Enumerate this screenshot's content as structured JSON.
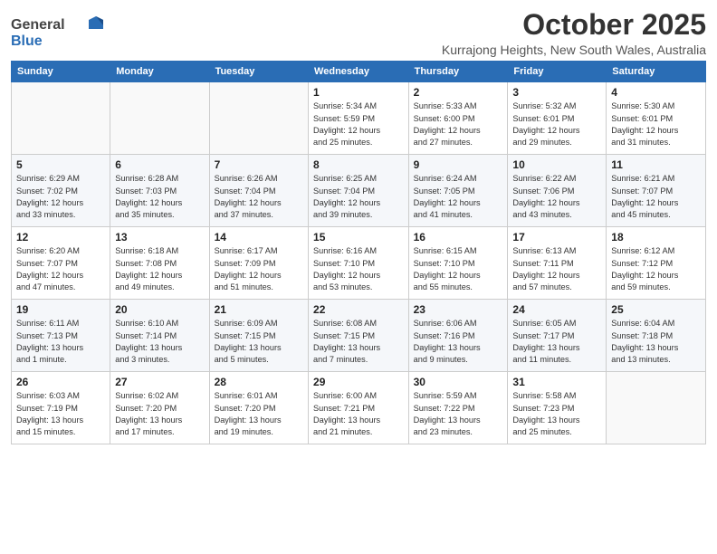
{
  "logo": {
    "general": "General",
    "blue": "Blue"
  },
  "header": {
    "month_title": "October 2025",
    "location": "Kurrajong Heights, New South Wales, Australia"
  },
  "weekdays": [
    "Sunday",
    "Monday",
    "Tuesday",
    "Wednesday",
    "Thursday",
    "Friday",
    "Saturday"
  ],
  "weeks": [
    [
      {
        "day": "",
        "info": ""
      },
      {
        "day": "",
        "info": ""
      },
      {
        "day": "",
        "info": ""
      },
      {
        "day": "1",
        "info": "Sunrise: 5:34 AM\nSunset: 5:59 PM\nDaylight: 12 hours\nand 25 minutes."
      },
      {
        "day": "2",
        "info": "Sunrise: 5:33 AM\nSunset: 6:00 PM\nDaylight: 12 hours\nand 27 minutes."
      },
      {
        "day": "3",
        "info": "Sunrise: 5:32 AM\nSunset: 6:01 PM\nDaylight: 12 hours\nand 29 minutes."
      },
      {
        "day": "4",
        "info": "Sunrise: 5:30 AM\nSunset: 6:01 PM\nDaylight: 12 hours\nand 31 minutes."
      }
    ],
    [
      {
        "day": "5",
        "info": "Sunrise: 6:29 AM\nSunset: 7:02 PM\nDaylight: 12 hours\nand 33 minutes."
      },
      {
        "day": "6",
        "info": "Sunrise: 6:28 AM\nSunset: 7:03 PM\nDaylight: 12 hours\nand 35 minutes."
      },
      {
        "day": "7",
        "info": "Sunrise: 6:26 AM\nSunset: 7:04 PM\nDaylight: 12 hours\nand 37 minutes."
      },
      {
        "day": "8",
        "info": "Sunrise: 6:25 AM\nSunset: 7:04 PM\nDaylight: 12 hours\nand 39 minutes."
      },
      {
        "day": "9",
        "info": "Sunrise: 6:24 AM\nSunset: 7:05 PM\nDaylight: 12 hours\nand 41 minutes."
      },
      {
        "day": "10",
        "info": "Sunrise: 6:22 AM\nSunset: 7:06 PM\nDaylight: 12 hours\nand 43 minutes."
      },
      {
        "day": "11",
        "info": "Sunrise: 6:21 AM\nSunset: 7:07 PM\nDaylight: 12 hours\nand 45 minutes."
      }
    ],
    [
      {
        "day": "12",
        "info": "Sunrise: 6:20 AM\nSunset: 7:07 PM\nDaylight: 12 hours\nand 47 minutes."
      },
      {
        "day": "13",
        "info": "Sunrise: 6:18 AM\nSunset: 7:08 PM\nDaylight: 12 hours\nand 49 minutes."
      },
      {
        "day": "14",
        "info": "Sunrise: 6:17 AM\nSunset: 7:09 PM\nDaylight: 12 hours\nand 51 minutes."
      },
      {
        "day": "15",
        "info": "Sunrise: 6:16 AM\nSunset: 7:10 PM\nDaylight: 12 hours\nand 53 minutes."
      },
      {
        "day": "16",
        "info": "Sunrise: 6:15 AM\nSunset: 7:10 PM\nDaylight: 12 hours\nand 55 minutes."
      },
      {
        "day": "17",
        "info": "Sunrise: 6:13 AM\nSunset: 7:11 PM\nDaylight: 12 hours\nand 57 minutes."
      },
      {
        "day": "18",
        "info": "Sunrise: 6:12 AM\nSunset: 7:12 PM\nDaylight: 12 hours\nand 59 minutes."
      }
    ],
    [
      {
        "day": "19",
        "info": "Sunrise: 6:11 AM\nSunset: 7:13 PM\nDaylight: 13 hours\nand 1 minute."
      },
      {
        "day": "20",
        "info": "Sunrise: 6:10 AM\nSunset: 7:14 PM\nDaylight: 13 hours\nand 3 minutes."
      },
      {
        "day": "21",
        "info": "Sunrise: 6:09 AM\nSunset: 7:15 PM\nDaylight: 13 hours\nand 5 minutes."
      },
      {
        "day": "22",
        "info": "Sunrise: 6:08 AM\nSunset: 7:15 PM\nDaylight: 13 hours\nand 7 minutes."
      },
      {
        "day": "23",
        "info": "Sunrise: 6:06 AM\nSunset: 7:16 PM\nDaylight: 13 hours\nand 9 minutes."
      },
      {
        "day": "24",
        "info": "Sunrise: 6:05 AM\nSunset: 7:17 PM\nDaylight: 13 hours\nand 11 minutes."
      },
      {
        "day": "25",
        "info": "Sunrise: 6:04 AM\nSunset: 7:18 PM\nDaylight: 13 hours\nand 13 minutes."
      }
    ],
    [
      {
        "day": "26",
        "info": "Sunrise: 6:03 AM\nSunset: 7:19 PM\nDaylight: 13 hours\nand 15 minutes."
      },
      {
        "day": "27",
        "info": "Sunrise: 6:02 AM\nSunset: 7:20 PM\nDaylight: 13 hours\nand 17 minutes."
      },
      {
        "day": "28",
        "info": "Sunrise: 6:01 AM\nSunset: 7:20 PM\nDaylight: 13 hours\nand 19 minutes."
      },
      {
        "day": "29",
        "info": "Sunrise: 6:00 AM\nSunset: 7:21 PM\nDaylight: 13 hours\nand 21 minutes."
      },
      {
        "day": "30",
        "info": "Sunrise: 5:59 AM\nSunset: 7:22 PM\nDaylight: 13 hours\nand 23 minutes."
      },
      {
        "day": "31",
        "info": "Sunrise: 5:58 AM\nSunset: 7:23 PM\nDaylight: 13 hours\nand 25 minutes."
      },
      {
        "day": "",
        "info": ""
      }
    ]
  ]
}
